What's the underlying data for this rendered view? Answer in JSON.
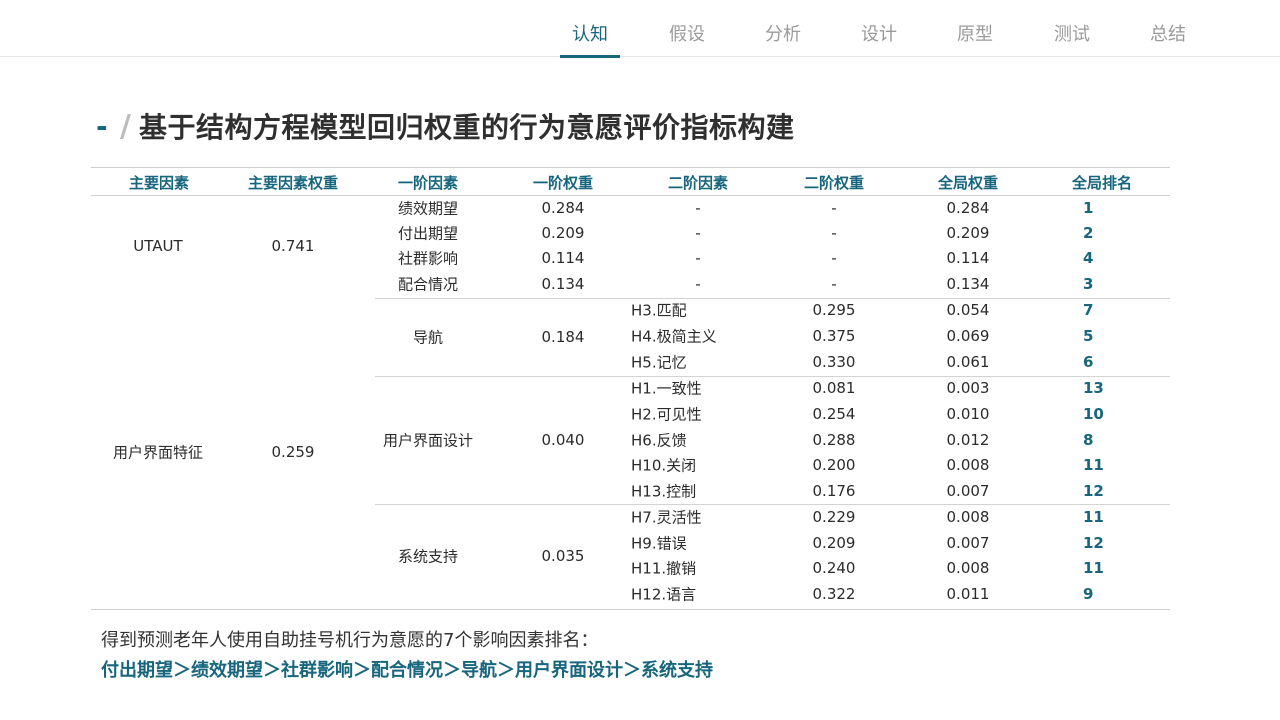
{
  "nav": {
    "tabs": [
      {
        "label": "认知",
        "active": true
      },
      {
        "label": "假设",
        "active": false
      },
      {
        "label": "分析",
        "active": false
      },
      {
        "label": "设计",
        "active": false
      },
      {
        "label": "原型",
        "active": false
      },
      {
        "label": "测试",
        "active": false
      },
      {
        "label": "总结",
        "active": false
      }
    ]
  },
  "title": {
    "mark": "-",
    "slash": "/",
    "text": "基于结构方程模型回归权重的行为意愿评价指标构建"
  },
  "table": {
    "headers": [
      "主要因素",
      "主要因素权重",
      "一阶因素",
      "一阶权重",
      "二阶因素",
      "二阶权重",
      "全局权重",
      "全局排名"
    ],
    "main_groups": [
      {
        "name": "UTAUT",
        "weight": "0.741"
      },
      {
        "name": "用户界面特征",
        "weight": "0.259"
      }
    ],
    "first_order_groups": [
      {
        "name": "导航",
        "weight": "0.184"
      },
      {
        "name": "用户界面设计",
        "weight": "0.040"
      },
      {
        "name": "系统支持",
        "weight": "0.035"
      }
    ],
    "rows": [
      {
        "first": "绩效期望",
        "first_w": "0.284",
        "second": "-",
        "second_w": "-",
        "global": "0.284",
        "rank": "1"
      },
      {
        "first": "付出期望",
        "first_w": "0.209",
        "second": "-",
        "second_w": "-",
        "global": "0.209",
        "rank": "2"
      },
      {
        "first": "社群影响",
        "first_w": "0.114",
        "second": "-",
        "second_w": "-",
        "global": "0.114",
        "rank": "4"
      },
      {
        "first": "配合情况",
        "first_w": "0.134",
        "second": "-",
        "second_w": "-",
        "global": "0.134",
        "rank": "3"
      },
      {
        "second": "H3.匹配",
        "second_w": "0.295",
        "global": "0.054",
        "rank": "7"
      },
      {
        "second": "H4.极简主义",
        "second_w": "0.375",
        "global": "0.069",
        "rank": "5"
      },
      {
        "second": "H5.记忆",
        "second_w": "0.330",
        "global": "0.061",
        "rank": "6"
      },
      {
        "second": "H1.一致性",
        "second_w": "0.081",
        "global": "0.003",
        "rank": "13"
      },
      {
        "second": "H2.可见性",
        "second_w": "0.254",
        "global": "0.010",
        "rank": "10"
      },
      {
        "second": "H6.反馈",
        "second_w": "0.288",
        "global": "0.012",
        "rank": "8"
      },
      {
        "second": "H10.关闭",
        "second_w": "0.200",
        "global": "0.008",
        "rank": "11"
      },
      {
        "second": "H13.控制",
        "second_w": "0.176",
        "global": "0.007",
        "rank": "12"
      },
      {
        "second": "H7.灵活性",
        "second_w": "0.229",
        "global": "0.008",
        "rank": "11"
      },
      {
        "second": "H9.错误",
        "second_w": "0.209",
        "global": "0.007",
        "rank": "12"
      },
      {
        "second": "H11.撤销",
        "second_w": "0.240",
        "global": "0.008",
        "rank": "11"
      },
      {
        "second": "H12.语言",
        "second_w": "0.322",
        "global": "0.011",
        "rank": "9"
      }
    ]
  },
  "summary": {
    "text": "得到预测老年人使用自助挂号机行为意愿的7个影响因素排名：",
    "chain": "付出期望＞绩效期望＞社群影响＞配合情况＞导航＞用户界面设计＞系统支持"
  },
  "colors": {
    "accent": "#17667e",
    "muted": "#9a9a9a",
    "rule": "#d3d3d3"
  }
}
